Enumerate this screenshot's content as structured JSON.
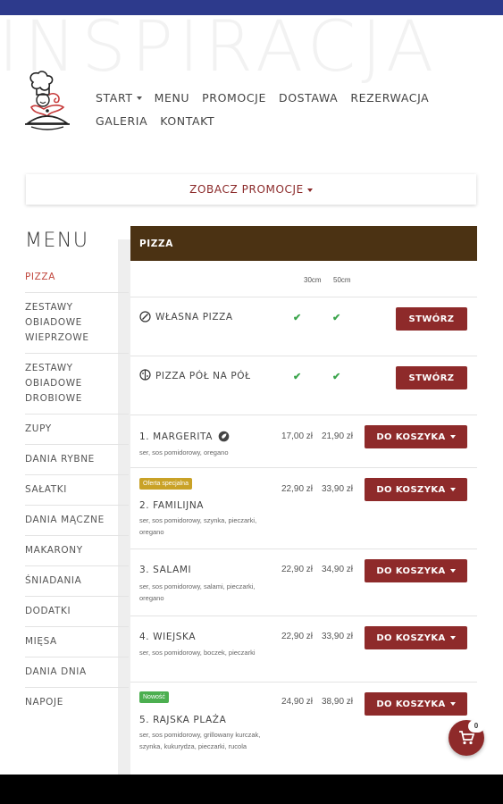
{
  "watermark": "INSPIRACJA",
  "nav": {
    "row1": [
      "START",
      "MENU",
      "PROMOCJE",
      "DOSTAWA",
      "REZERWACJA"
    ],
    "row2": [
      "GALERIA",
      "KONTAKT"
    ]
  },
  "promo_button": "ZOBACZ PROMOCJE",
  "menu_title": "MENU",
  "sidebar": [
    "PIZZA",
    "ZESTAWY OBIADOWE WIEPRZOWE",
    "ZESTAWY OBIADOWE DROBIOWE",
    "ZUPY",
    "DANIA RYBNE",
    "SAŁATKI",
    "DANIA MĄCZNE",
    "MAKARONY",
    "ŚNIADANIA",
    "DODATKI",
    "MIĘSA",
    "DANIA DNIA",
    "NAPOJE"
  ],
  "category": "PIZZA",
  "sizes": [
    "30cm",
    "50cm"
  ],
  "own": [
    {
      "name": "WŁASNA PIZZA",
      "button": "STWÓRZ"
    },
    {
      "name": "PIZZA PÓŁ NA PÓŁ",
      "button": "STWÓRZ"
    }
  ],
  "items": [
    {
      "name": "1. MARGERITA",
      "desc": "ser, sos pomidorowy, oregano",
      "price30": "17,00 zł",
      "price50": "21,90 zł",
      "button": "DO KOSZYKA",
      "badge": ""
    },
    {
      "name": "2. FAMILIJNA",
      "desc": "ser, sos pomidorowy, szynka, pieczarki, oregano",
      "price30": "22,90 zł",
      "price50": "33,90 zł",
      "button": "DO KOSZYKA",
      "badge": "Oferta specjalna"
    },
    {
      "name": "3. SALAMI",
      "desc": "ser, sos pomidorowy, salami, pieczarki, oregano",
      "price30": "22,90 zł",
      "price50": "34,90 zł",
      "button": "DO KOSZYKA",
      "badge": ""
    },
    {
      "name": "4. WIEJSKA",
      "desc": "ser, sos pomidorowy, boczek, pieczarki",
      "price30": "22,90 zł",
      "price50": "33,90 zł",
      "button": "DO KOSZYKA",
      "badge": ""
    },
    {
      "name": "5. RAJSKA PLAŻA",
      "desc": "ser, sos pomidorowy, grillowany kurczak, szynka, kukurydza, pieczarki, rucola",
      "price30": "24,90 zł",
      "price50": "38,90 zł",
      "button": "DO KOSZYKA",
      "badge": "Nowość"
    }
  ],
  "cart_count": "0",
  "colors": {
    "accent": "#8e2a2a",
    "header": "#4b3213",
    "badge_special": "#c9a227",
    "badge_new": "#4caf50",
    "check": "#3aa44b"
  }
}
